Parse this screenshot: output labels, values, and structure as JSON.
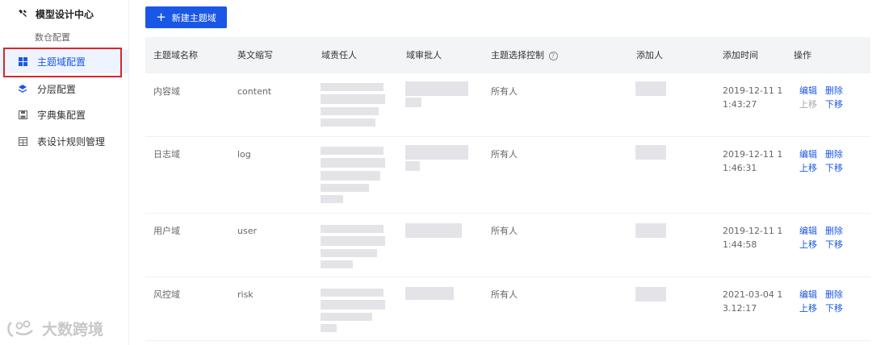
{
  "sidebar": {
    "group_label": "模型设计中心",
    "sub_label": "数仓配置",
    "items": [
      {
        "label": "主题域配置",
        "icon": "grid-icon",
        "active": true
      },
      {
        "label": "分层配置",
        "icon": "layers-icon",
        "active": false
      },
      {
        "label": "字典集配置",
        "icon": "save-icon",
        "active": false
      },
      {
        "label": "表设计规则管理",
        "icon": "table-icon",
        "active": false
      }
    ]
  },
  "toolbar": {
    "new_button_label": "新建主题域",
    "new_button_icon": "plus-icon"
  },
  "table": {
    "headers": {
      "name": "主题域名称",
      "abbr": "英文缩写",
      "owner": "域责任人",
      "approver": "域审批人",
      "control": "主题选择控制",
      "creator": "添加人",
      "time": "添加时间",
      "actions": "操作"
    },
    "control_help_icon": "question-circle-icon",
    "rows": [
      {
        "name": "内容域",
        "abbr": "content",
        "control": "所有人",
        "time": "2019-12-11 11:43:27",
        "edit": "编辑",
        "delete": "删除",
        "up": "上移",
        "down": "下移",
        "up_enabled": false
      },
      {
        "name": "日志域",
        "abbr": "log",
        "control": "所有人",
        "time": "2019-12-11 11:46:31",
        "edit": "编辑",
        "delete": "删除",
        "up": "上移",
        "down": "下移",
        "up_enabled": true
      },
      {
        "name": "用户域",
        "abbr": "user",
        "control": "所有人",
        "time": "2019-12-11 11:44:58",
        "edit": "编辑",
        "delete": "删除",
        "up": "上移",
        "down": "下移",
        "up_enabled": true
      },
      {
        "name": "风控域",
        "abbr": "risk",
        "control": "所有人",
        "time": "2021-03-04 13.12:17",
        "edit": "编辑",
        "delete": "删除",
        "up": "上移",
        "down": "下移",
        "up_enabled": true
      }
    ]
  },
  "watermark": {
    "text": "大数跨境"
  },
  "colors": {
    "primary": "#1a57e6",
    "highlight_border": "#d9262c",
    "header_bg": "#f3f4f6"
  }
}
